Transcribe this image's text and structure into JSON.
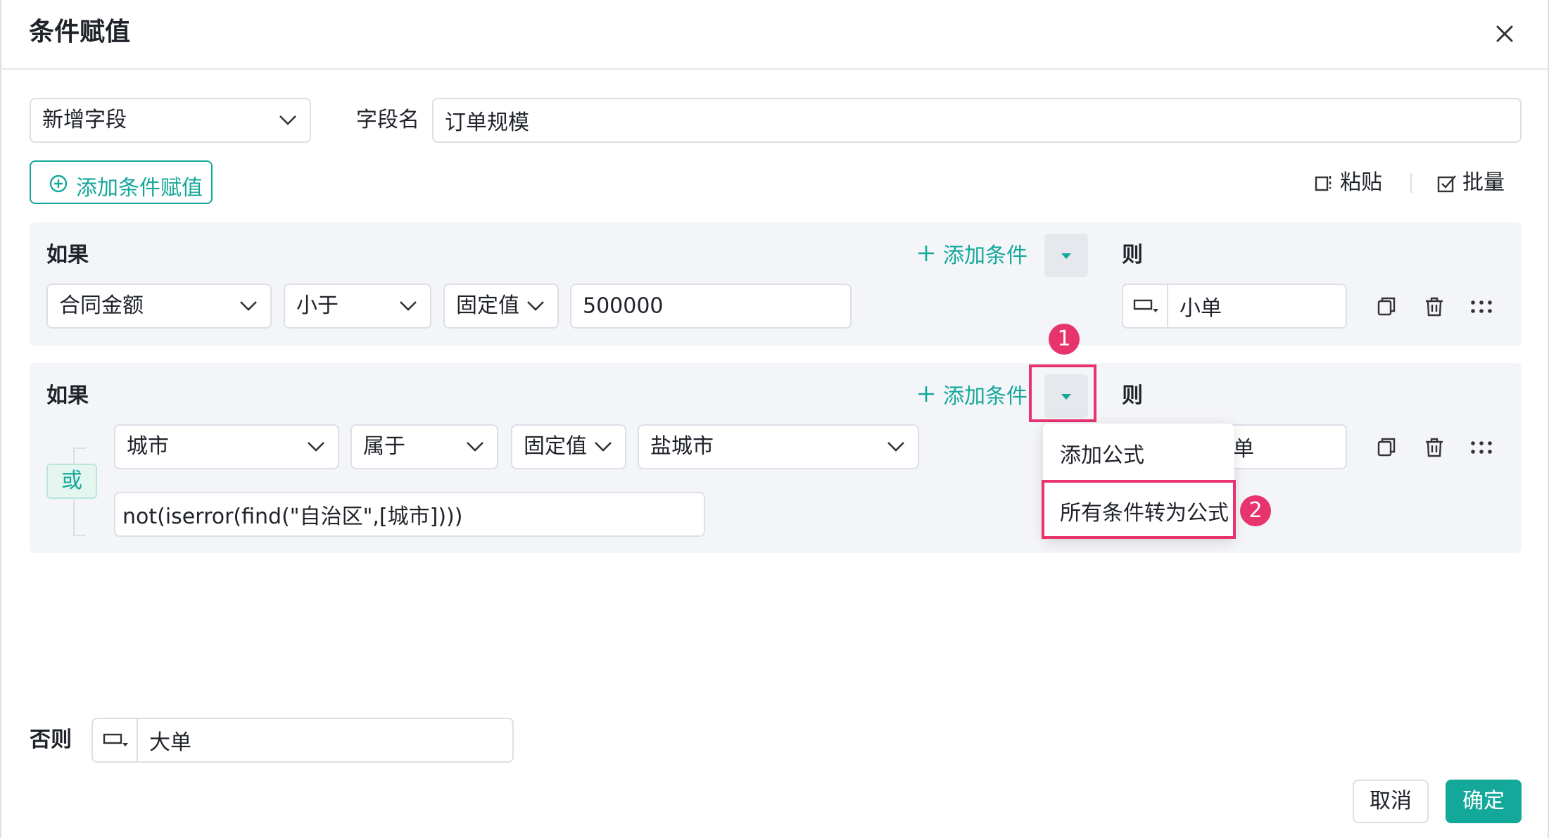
{
  "dialog": {
    "title": "条件赋值"
  },
  "field": {
    "mode_select": "新增字段",
    "name_label": "字段名",
    "name_value": "订单规模"
  },
  "toolbar": {
    "add_condition_value": "添加条件赋值",
    "paste": "粘贴",
    "batch": "批量"
  },
  "rule1": {
    "if_label": "如果",
    "add_condition": "添加条件",
    "then_label": "则",
    "field": "合同金额",
    "operator": "小于",
    "value_type": "固定值",
    "value": "500000",
    "result": "小单"
  },
  "rule2": {
    "if_label": "如果",
    "add_condition": "添加条件",
    "then_label": "则",
    "logic": "或",
    "field": "城市",
    "operator": "属于",
    "value_type": "固定值",
    "value": "盐城市",
    "formula": "not(iserror(find(\"自治区\",[城市])))",
    "result_partial": "单"
  },
  "dropdown_menu": {
    "items": [
      "添加公式",
      "所有条件转为公式"
    ]
  },
  "annotations": {
    "step1": "1",
    "step2": "2",
    "highlight_color": "#e8346e"
  },
  "else": {
    "label": "否则",
    "value": "大单"
  },
  "footer": {
    "cancel": "取消",
    "confirm": "确定"
  },
  "colors": {
    "accent": "#14a89a",
    "panel_bg": "#f4f5f8"
  },
  "icons": {
    "close": "close-icon",
    "chevron": "chevron-down-icon",
    "plus_circle": "plus-circle-icon",
    "paste": "paste-icon",
    "batch": "batch-edit-icon",
    "plus": "plus-icon",
    "field_type": "field-type-icon",
    "copy": "copy-icon",
    "delete": "trash-icon",
    "drag": "drag-handle-icon",
    "menu_trigger": "caret-down-icon"
  }
}
